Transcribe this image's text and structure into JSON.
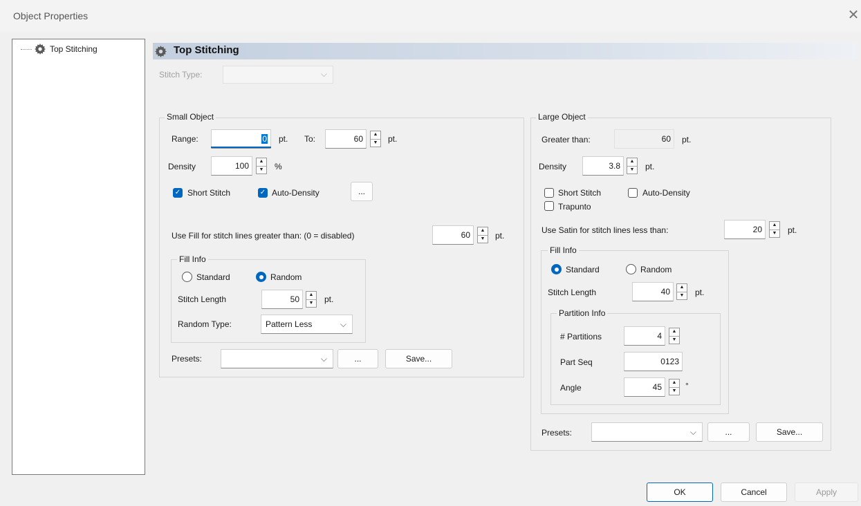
{
  "window": {
    "title": "Object Properties",
    "close": "✕"
  },
  "tree": {
    "item": "Top Stitching"
  },
  "header": {
    "title": "Top Stitching"
  },
  "stitch_type": {
    "label": "Stitch Type:",
    "value": ""
  },
  "small": {
    "title": "Small Object",
    "range_label": "Range:",
    "range_value": "0",
    "range_unit": "pt.",
    "to_label": "To:",
    "to_value": "60",
    "to_unit": "pt.",
    "density_label": "Density",
    "density_value": "100",
    "density_unit": "%",
    "short_stitch": "Short Stitch",
    "auto_density": "Auto-Density",
    "dots": "...",
    "use_fill_label": "Use Fill for stitch lines greater than: (0 = disabled)",
    "use_fill_value": "60",
    "use_fill_unit": "pt.",
    "fill_info": {
      "title": "Fill Info",
      "standard": "Standard",
      "random": "Random",
      "stitch_length_label": "Stitch Length",
      "stitch_length_value": "50",
      "stitch_length_unit": "pt.",
      "random_type_label": "Random Type:",
      "random_type_value": "Pattern Less"
    },
    "presets_label": "Presets:",
    "presets_value": "",
    "presets_dots": "...",
    "save": "Save..."
  },
  "large": {
    "title": "Large Object",
    "greater_label": "Greater than:",
    "greater_value": "60",
    "greater_unit": "pt.",
    "density_label": "Density",
    "density_value": "3.8",
    "density_unit": "pt.",
    "short_stitch": "Short Stitch",
    "auto_density": "Auto-Density",
    "trapunto": "Trapunto",
    "use_satin_label": "Use Satin for stitch lines less than:",
    "use_satin_value": "20",
    "use_satin_unit": "pt.",
    "fill_info": {
      "title": "Fill Info",
      "standard": "Standard",
      "random": "Random",
      "stitch_length_label": "Stitch Length",
      "stitch_length_value": "40",
      "stitch_length_unit": "pt."
    },
    "partition": {
      "title": "Partition Info",
      "partitions_label": "# Partitions",
      "partitions_value": "4",
      "part_seq_label": "Part Seq",
      "part_seq_value": "0123",
      "angle_label": "Angle",
      "angle_value": "45",
      "angle_unit": "°"
    },
    "presets_label": "Presets:",
    "presets_value": "",
    "presets_dots": "...",
    "save": "Save..."
  },
  "footer": {
    "ok": "OK",
    "cancel": "Cancel",
    "apply": "Apply"
  },
  "colors": {
    "accent": "#0067c0",
    "header_bar": "#c3cfdf"
  }
}
